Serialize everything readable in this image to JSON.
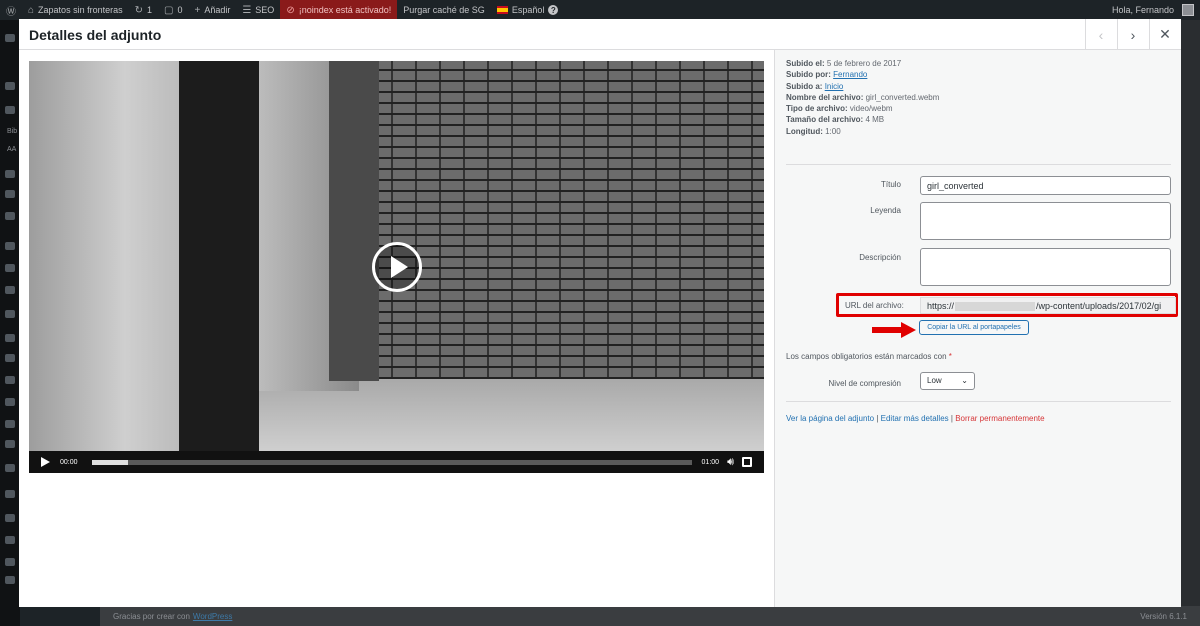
{
  "adminbar": {
    "site_name": "Zapatos sin fronteras",
    "updates_count": "1",
    "comments_count": "0",
    "add_label": "Añadir",
    "seo_label": "SEO",
    "noindex_label": "¡noindex está activado!",
    "purge_label": "Purgar caché de SG",
    "language_label": "Español",
    "greeting": "Hola, Fernando"
  },
  "sidebar": {
    "partial_text_1": "Bib",
    "partial_text_2": "AA"
  },
  "footer": {
    "thanks_text": "Gracias por crear con",
    "wordpress_link": "WordPress",
    "version": "Versión 6.1.1"
  },
  "modal": {
    "title": "Detalles del adjunto",
    "prev_icon": "chevron-left-icon",
    "next_icon": "chevron-right-icon",
    "close_icon": "close-icon"
  },
  "video": {
    "current_time": "00:00",
    "duration": "01:00",
    "progress_percent": 6
  },
  "details": {
    "meta": [
      {
        "label": "Subido el:",
        "value": "5 de febrero de 2017",
        "link": false
      },
      {
        "label": "Subido por:",
        "value": "Fernando",
        "link": true
      },
      {
        "label": "Subido a:",
        "value": "Inicio",
        "link": true
      },
      {
        "label": "Nombre del archivo:",
        "value": "girl_converted.webm",
        "link": false
      },
      {
        "label": "Tipo de archivo:",
        "value": "video/webm",
        "link": false
      },
      {
        "label": "Tamaño del archivo:",
        "value": "4 MB",
        "link": false
      },
      {
        "label": "Longitud:",
        "value": "1:00",
        "link": false
      }
    ],
    "title_label": "Título",
    "title_value": "girl_converted",
    "caption_label": "Leyenda",
    "caption_value": "",
    "description_label": "Descripción",
    "description_value": "",
    "url_label": "URL del archivo:",
    "url_prefix": "https://",
    "url_suffix": "/wp-content/uploads/2017/02/gi",
    "copy_button": "Copiar la URL al portapapeles",
    "required_text": "Los campos obligatorios están marcados con",
    "required_star": "*",
    "compression_label": "Nivel de compresión",
    "compression_value": "Low",
    "link_view": "Ver la página del adjunto",
    "link_edit": "Editar más detalles",
    "link_delete": "Borrar permanentemente",
    "link_sep": "|"
  },
  "colors": {
    "highlight_border": "#e00000",
    "link": "#2271b1",
    "danger": "#d63638"
  }
}
